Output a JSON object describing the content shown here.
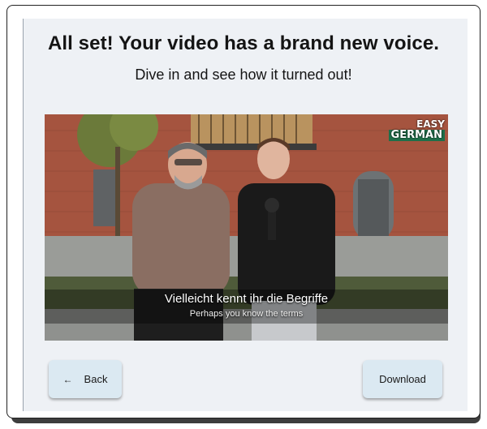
{
  "header": {
    "title": "All set! Your video has a brand new voice.",
    "subtitle": "Dive in and see how it turned out!"
  },
  "video": {
    "logo_line1": "EASY",
    "logo_line2": "GERMAN",
    "subtitle_primary": "Vielleicht kennt ihr die Begriffe",
    "subtitle_secondary": "Perhaps you know the terms"
  },
  "actions": {
    "back_icon": "←",
    "back_label": "Back",
    "download_label": "Download"
  }
}
